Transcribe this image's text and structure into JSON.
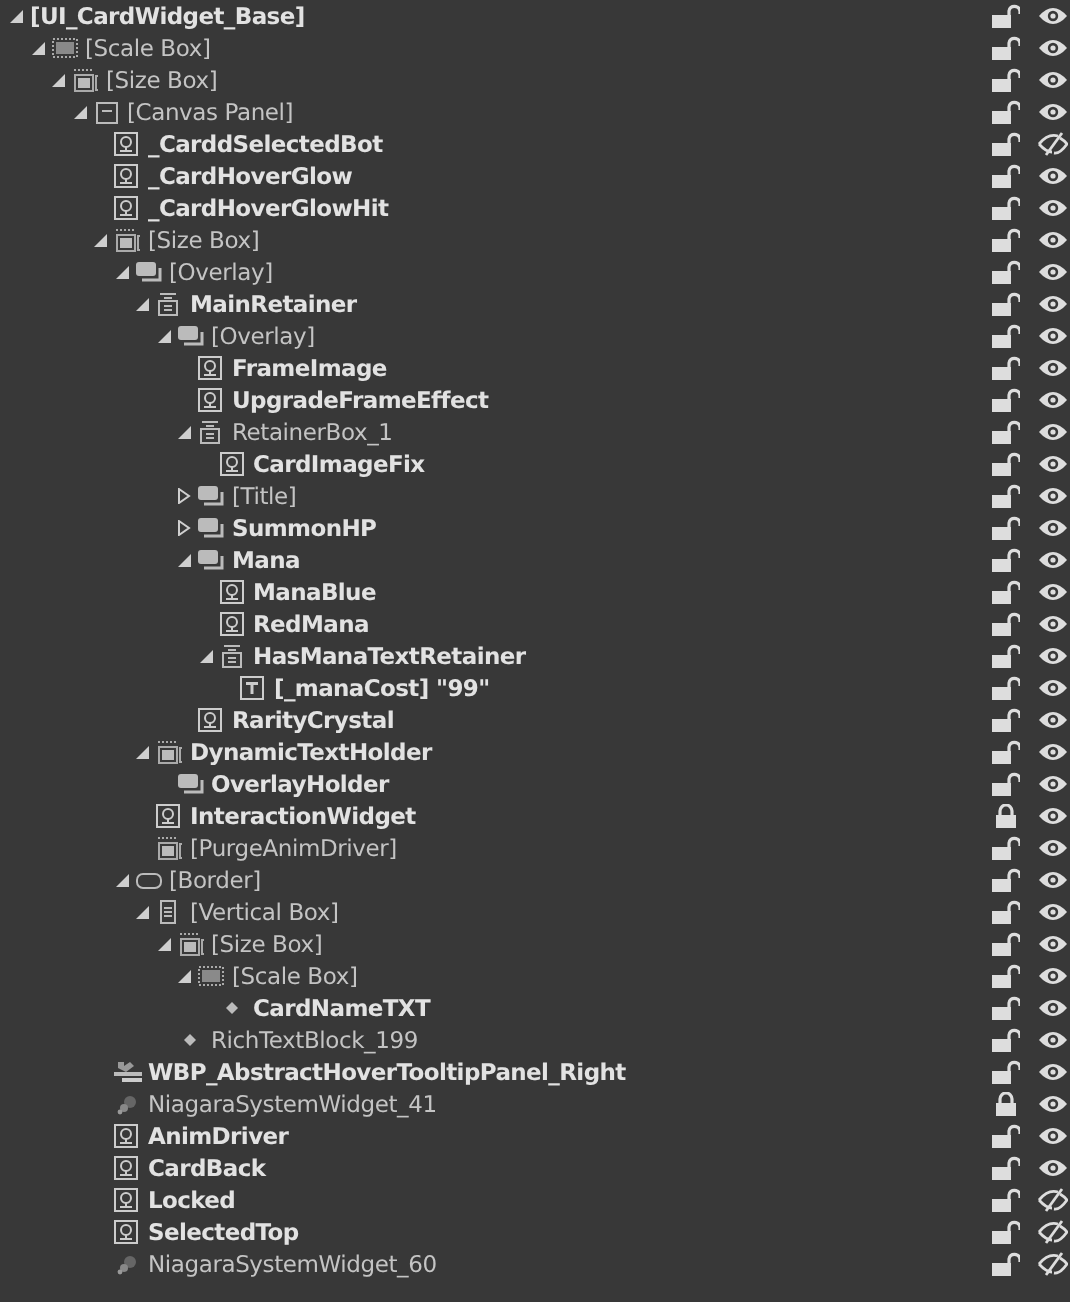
{
  "hierarchy": [
    {
      "label": "[UI_CardWidget_Base]",
      "bold": true,
      "expanded": true,
      "locked": false,
      "visible": true,
      "children": [
        {
          "label": "[Scale Box]",
          "kind": "scalebox",
          "bold": false,
          "expanded": true,
          "locked": false,
          "visible": true,
          "children": [
            {
              "label": "[Size Box]",
              "kind": "sizebox",
              "bold": false,
              "expanded": true,
              "locked": false,
              "visible": true,
              "children": [
                {
                  "label": "[Canvas Panel]",
                  "kind": "canvas",
                  "bold": false,
                  "expanded": true,
                  "locked": false,
                  "visible": true,
                  "children": [
                    {
                      "label": "_CarddSelectedBot",
                      "kind": "image",
                      "bold": true,
                      "locked": false,
                      "visible": false
                    },
                    {
                      "label": "_CardHoverGlow",
                      "kind": "image",
                      "bold": true,
                      "locked": false,
                      "visible": true
                    },
                    {
                      "label": "_CardHoverGlowHit",
                      "kind": "image",
                      "bold": true,
                      "locked": false,
                      "visible": true
                    },
                    {
                      "label": "[Size Box]",
                      "kind": "sizebox",
                      "bold": false,
                      "expanded": true,
                      "locked": false,
                      "visible": true,
                      "children": [
                        {
                          "label": "[Overlay]",
                          "kind": "overlay",
                          "bold": false,
                          "expanded": true,
                          "locked": false,
                          "visible": true,
                          "children": [
                            {
                              "label": "MainRetainer",
                              "kind": "retainer",
                              "bold": true,
                              "expanded": true,
                              "locked": false,
                              "visible": true,
                              "children": [
                                {
                                  "label": "[Overlay]",
                                  "kind": "overlay",
                                  "bold": false,
                                  "expanded": true,
                                  "locked": false,
                                  "visible": true,
                                  "children": [
                                    {
                                      "label": "FrameImage",
                                      "kind": "image",
                                      "bold": true,
                                      "locked": false,
                                      "visible": true
                                    },
                                    {
                                      "label": "UpgradeFrameEffect",
                                      "kind": "image",
                                      "bold": true,
                                      "locked": false,
                                      "visible": true
                                    },
                                    {
                                      "label": "RetainerBox_1",
                                      "kind": "retainer",
                                      "bold": false,
                                      "expanded": true,
                                      "locked": false,
                                      "visible": true,
                                      "children": [
                                        {
                                          "label": "CardImageFix",
                                          "kind": "image",
                                          "bold": true,
                                          "locked": false,
                                          "visible": true
                                        }
                                      ]
                                    },
                                    {
                                      "label": "[Title]",
                                      "kind": "overlay",
                                      "bold": false,
                                      "expanded": false,
                                      "locked": false,
                                      "visible": true
                                    },
                                    {
                                      "label": "SummonHP",
                                      "kind": "overlay",
                                      "bold": true,
                                      "expanded": false,
                                      "locked": false,
                                      "visible": true
                                    },
                                    {
                                      "label": "Mana",
                                      "kind": "overlay",
                                      "bold": true,
                                      "expanded": true,
                                      "locked": false,
                                      "visible": true,
                                      "children": [
                                        {
                                          "label": "ManaBlue",
                                          "kind": "image",
                                          "bold": true,
                                          "locked": false,
                                          "visible": true
                                        },
                                        {
                                          "label": "RedMana",
                                          "kind": "image",
                                          "bold": true,
                                          "locked": false,
                                          "visible": true
                                        },
                                        {
                                          "label": "HasManaTextRetainer",
                                          "kind": "retainer",
                                          "bold": true,
                                          "expanded": true,
                                          "locked": false,
                                          "visible": true,
                                          "children": [
                                            {
                                              "label": "[_manaCost] \"99\"",
                                              "kind": "text",
                                              "bold": true,
                                              "locked": false,
                                              "visible": true
                                            }
                                          ]
                                        }
                                      ]
                                    },
                                    {
                                      "label": "RarityCrystal",
                                      "kind": "image",
                                      "bold": true,
                                      "locked": false,
                                      "visible": true
                                    }
                                  ]
                                }
                              ]
                            },
                            {
                              "label": "DynamicTextHolder",
                              "kind": "sizebox",
                              "bold": true,
                              "expanded": true,
                              "locked": false,
                              "visible": true,
                              "children": [
                                {
                                  "label": "OverlayHolder",
                                  "kind": "overlay",
                                  "bold": true,
                                  "locked": false,
                                  "visible": true
                                }
                              ]
                            },
                            {
                              "label": "InteractionWidget",
                              "kind": "image",
                              "bold": true,
                              "locked": true,
                              "visible": true
                            },
                            {
                              "label": "[PurgeAnimDriver]",
                              "kind": "sizebox",
                              "bold": false,
                              "locked": false,
                              "visible": true
                            }
                          ]
                        },
                        {
                          "label": "[Border]",
                          "kind": "border",
                          "bold": false,
                          "expanded": true,
                          "locked": false,
                          "visible": true,
                          "children": [
                            {
                              "label": "[Vertical Box]",
                              "kind": "vbox",
                              "bold": false,
                              "expanded": true,
                              "locked": false,
                              "visible": true,
                              "children": [
                                {
                                  "label": "[Size Box]",
                                  "kind": "sizebox",
                                  "bold": false,
                                  "expanded": true,
                                  "locked": false,
                                  "visible": true,
                                  "children": [
                                    {
                                      "label": "[Scale Box]",
                                      "kind": "scalebox",
                                      "bold": false,
                                      "expanded": true,
                                      "locked": false,
                                      "visible": true,
                                      "children": [
                                        {
                                          "label": "CardNameTXT",
                                          "kind": "diamond",
                                          "bold": true,
                                          "locked": false,
                                          "visible": true
                                        }
                                      ]
                                    }
                                  ]
                                },
                                {
                                  "label": "RichTextBlock_199",
                                  "kind": "diamond",
                                  "bold": false,
                                  "locked": false,
                                  "visible": true
                                }
                              ]
                            }
                          ]
                        }
                      ]
                    },
                    {
                      "label": "WBP_AbstractHoverTooltipPanel_Right",
                      "kind": "userwidget",
                      "bold": true,
                      "locked": false,
                      "visible": true
                    },
                    {
                      "label": "NiagaraSystemWidget_41",
                      "kind": "niagara",
                      "bold": false,
                      "locked": true,
                      "visible": true
                    },
                    {
                      "label": "AnimDriver",
                      "kind": "image",
                      "bold": true,
                      "locked": false,
                      "visible": true
                    },
                    {
                      "label": "CardBack",
                      "kind": "image",
                      "bold": true,
                      "locked": false,
                      "visible": true
                    },
                    {
                      "label": "Locked",
                      "kind": "image",
                      "bold": true,
                      "locked": false,
                      "visible": false
                    },
                    {
                      "label": "SelectedTop",
                      "kind": "image",
                      "bold": true,
                      "locked": false,
                      "visible": false
                    },
                    {
                      "label": "NiagaraSystemWidget_60",
                      "kind": "niagara",
                      "bold": false,
                      "locked": false,
                      "visible": false
                    }
                  ]
                }
              ]
            }
          ]
        }
      ]
    }
  ]
}
